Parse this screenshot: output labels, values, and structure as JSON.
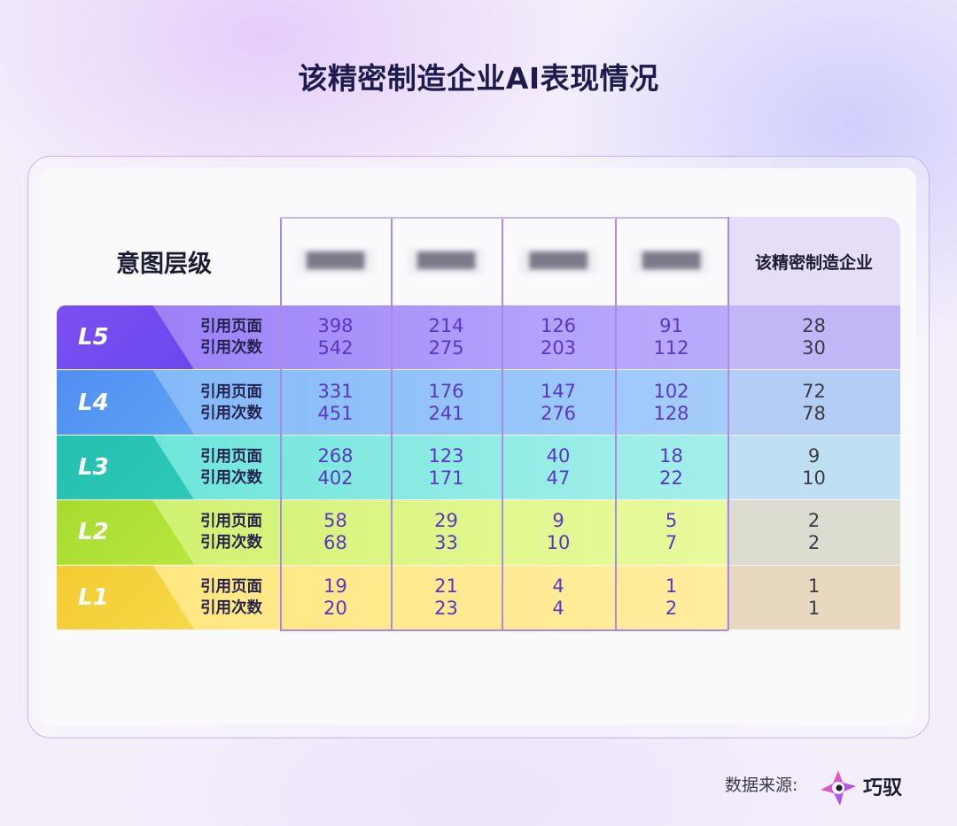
{
  "title": "该精密制造企业AI表现情况",
  "colors": {
    "L5": "#8a6cf4",
    "L4": "#6aaef4",
    "L3": "#5de2d6",
    "L2": "#c5ee5a",
    "L1": "#fde27a",
    "number_text": "#5a36c8",
    "highlight_column": "#e6def8"
  },
  "chart_data": {
    "type": "table",
    "title": "该精密制造企业AI表现情况",
    "corner_label": "意图层级",
    "columns": [
      {
        "label": "",
        "blurred": true
      },
      {
        "label": "",
        "blurred": true
      },
      {
        "label": "",
        "blurred": true
      },
      {
        "label": "",
        "blurred": true
      },
      {
        "label": "该精密制造企业",
        "blurred": false
      }
    ],
    "metric_labels": [
      "引用页面",
      "引用次数"
    ],
    "rows": [
      {
        "level": "L5",
        "pages": [
          "398",
          "214",
          "126",
          "91",
          "28"
        ],
        "counts": [
          "542",
          "275",
          "203",
          "112",
          "30"
        ]
      },
      {
        "level": "L4",
        "pages": [
          "331",
          "176",
          "147",
          "102",
          "72"
        ],
        "counts": [
          "451",
          "241",
          "276",
          "128",
          "78"
        ]
      },
      {
        "level": "L3",
        "pages": [
          "268",
          "123",
          "40",
          "18",
          "9"
        ],
        "counts": [
          "402",
          "171",
          "47",
          "22",
          "10"
        ]
      },
      {
        "level": "L2",
        "pages": [
          "58",
          "29",
          "9",
          "5",
          "2"
        ],
        "counts": [
          "68",
          "33",
          "10",
          "7",
          "2"
        ]
      },
      {
        "level": "L1",
        "pages": [
          "19",
          "21",
          "4",
          "1",
          "1"
        ],
        "counts": [
          "20",
          "23",
          "4",
          "2",
          "1"
        ]
      }
    ]
  },
  "footer": {
    "source_label": "数据来源:",
    "brand": "巧驭",
    "logo_icon": "qiaoyu-logo-icon"
  }
}
